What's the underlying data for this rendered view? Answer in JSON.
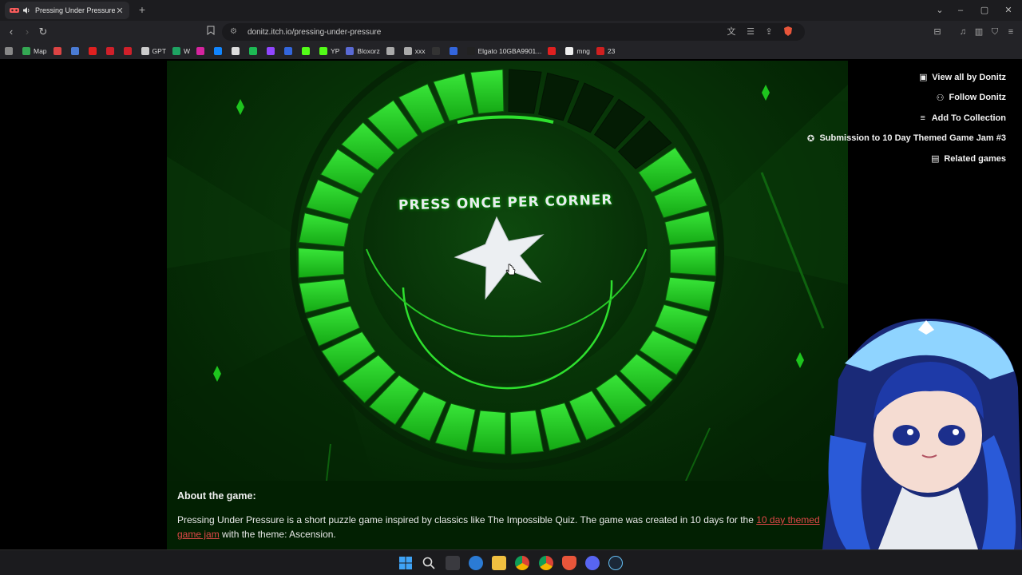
{
  "browser": {
    "tab": {
      "title": "Pressing Under Pressure by D",
      "favicon": "itch-icon"
    },
    "url": "donitz.itch.io/pressing-under-pressure",
    "bookmarks": [
      {
        "label": "",
        "icon": "apps-icon",
        "color": "#888888"
      },
      {
        "label": "Map",
        "icon": "map-icon",
        "color": "#34a853"
      },
      {
        "label": "",
        "icon": "bookmark-1",
        "color": "#d44"
      },
      {
        "label": "",
        "icon": "bookmark-2",
        "color": "#4a7bd4"
      },
      {
        "label": "",
        "icon": "youtube-icon",
        "color": "#e02020"
      },
      {
        "label": "",
        "icon": "pinterest-icon",
        "color": "#d0202a"
      },
      {
        "label": "",
        "icon": "pinterest-icon-2",
        "color": "#d0202a"
      },
      {
        "label": "GPT",
        "icon": "chatgpt-icon",
        "color": "#cccccc"
      },
      {
        "label": "W",
        "icon": "sheets-icon",
        "color": "#1ea362"
      },
      {
        "label": "",
        "icon": "instagram-icon",
        "color": "#d6249f"
      },
      {
        "label": "",
        "icon": "bluesky-icon",
        "color": "#1185fe"
      },
      {
        "label": "",
        "icon": "x-icon",
        "color": "#dddddd"
      },
      {
        "label": "",
        "icon": "spotify-icon",
        "color": "#1db954"
      },
      {
        "label": "",
        "icon": "twitch-icon",
        "color": "#9146ff"
      },
      {
        "label": "",
        "icon": "r-icon",
        "color": "#3366dd"
      },
      {
        "label": "",
        "icon": "kick-icon",
        "color": "#53fc18"
      },
      {
        "label": "YP",
        "icon": "yp-icon",
        "color": "#53fc18"
      },
      {
        "label": "Bloxorz",
        "icon": "bloxorz-icon",
        "color": "#5a6ad4"
      },
      {
        "label": "",
        "icon": "circle-icon",
        "color": "#aaaaaa"
      },
      {
        "label": "xxx",
        "icon": "folder-icon",
        "color": "#aaaaaa"
      },
      {
        "label": "",
        "icon": "dots-icon",
        "color": "#333333"
      },
      {
        "label": "",
        "icon": "m-icon",
        "color": "#3366dd"
      },
      {
        "label": "Elgato 10GBA9901...",
        "icon": "elgato-icon",
        "color": "#222222"
      },
      {
        "label": "",
        "icon": "slash-icon",
        "color": "#e02020"
      },
      {
        "label": "mng",
        "icon": "mng-icon",
        "color": "#eeeeee"
      },
      {
        "label": "23",
        "icon": "23-icon",
        "color": "#d02020"
      }
    ]
  },
  "game": {
    "prompt": "PRESS ONCE PER CORNER",
    "ring_segments_total": 34,
    "ring_segments_unlit": 5,
    "colors": {
      "segment": "#22cc22",
      "segment_dark": "#0a6a0a",
      "star": "#ebeef2"
    }
  },
  "sidebar": {
    "view_all": "View all by Donitz",
    "follow": "Follow Donitz",
    "add_collection": "Add To Collection",
    "submission": "Submission to 10 Day Themed Game Jam #3",
    "related": "Related games"
  },
  "about": {
    "heading": "About the game:",
    "text_before": "Pressing Under Pressure is a short puzzle game inspired by classics like The Impossible Quiz. The game was created in 10 days for the ",
    "link": "10 day themed game jam",
    "text_after": " with the theme: Ascension."
  }
}
